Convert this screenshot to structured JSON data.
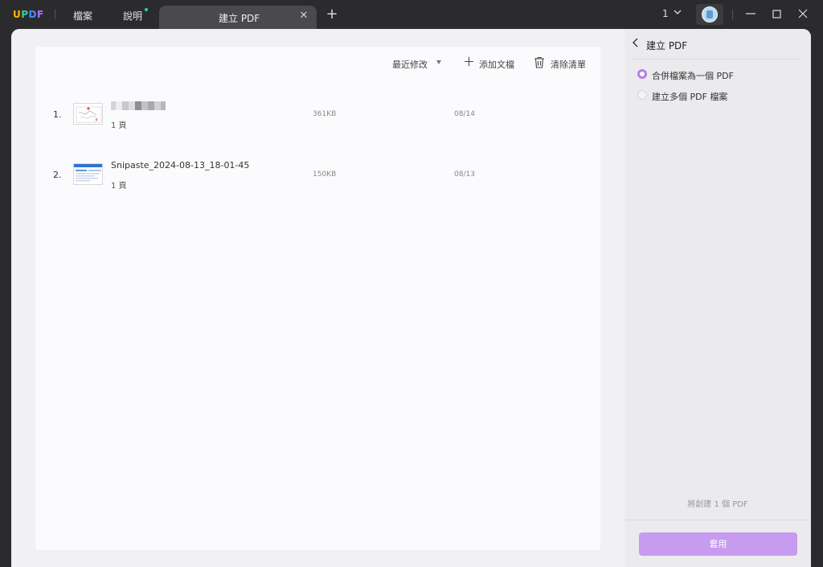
{
  "app": {
    "logo_letters": [
      {
        "char": "U",
        "color": "#ffb400"
      },
      {
        "char": "P",
        "color": "#38d18e"
      },
      {
        "char": "D",
        "color": "#3d8fff"
      },
      {
        "char": "F",
        "color": "#b56bff"
      }
    ]
  },
  "menu": {
    "file": "檔案",
    "help": "說明"
  },
  "tab": {
    "title": "建立 PDF",
    "close": "✕",
    "add": "+"
  },
  "window": {
    "page_count": "1",
    "minimize": "—",
    "maximize": "☐",
    "close": "✕"
  },
  "toolbar": {
    "sort": "最近修改",
    "add_file": "添加文檔",
    "clear_list": "清除清單"
  },
  "files": [
    {
      "index": "1.",
      "name": "",
      "pages": "1 頁",
      "size": "361KB",
      "date": "08/14",
      "thumb_icon": "sketch-thumbnail-icon"
    },
    {
      "index": "2.",
      "name": "Snipaste_2024-08-13_18-01-45",
      "pages": "1 頁",
      "size": "150KB",
      "date": "08/13",
      "thumb_icon": "screenshot-thumbnail-icon"
    }
  ],
  "side": {
    "title": "建立 PDF",
    "options": [
      {
        "label": "合併檔案為一個 PDF",
        "selected": true
      },
      {
        "label": "建立多個 PDF 檔案",
        "selected": false
      }
    ],
    "note": "將創建 1 個 PDF",
    "apply": "套用"
  },
  "colors": {
    "accent": "#c79bf0",
    "radio_on": "#b77ee6",
    "background": "#2b2b2d",
    "help_dot": "#2fd39a"
  }
}
